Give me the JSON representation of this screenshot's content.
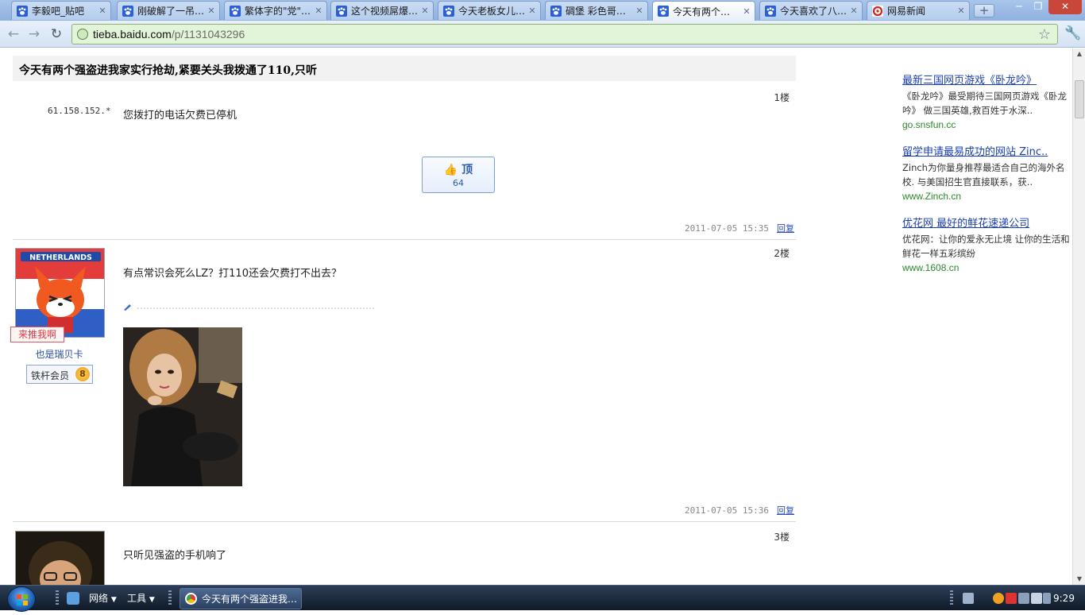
{
  "browser": {
    "tabs": [
      {
        "title": "李毅吧_贴吧",
        "active": false
      },
      {
        "title": "刚破解了一吊…",
        "active": false
      },
      {
        "title": "繁体字的\"党\"…",
        "active": false
      },
      {
        "title": "这个视频屌爆…",
        "active": false
      },
      {
        "title": "今天老板女儿…",
        "active": false
      },
      {
        "title": "碉堡 彩色哥…",
        "active": false
      },
      {
        "title": "今天有两个…",
        "active": true
      },
      {
        "title": "今天喜欢了八…",
        "active": false
      },
      {
        "title": "网易新闻",
        "active": false
      }
    ],
    "new_tab_label": "+",
    "url_host": "tieba.baidu.com",
    "url_path": "/p/1131043296",
    "window_controls": {
      "minimize": "─",
      "restore": "❐",
      "close": "✕"
    }
  },
  "thread": {
    "title": "今天有两个强盗进我家实行抢劫,紧要关头我拨通了110,只听",
    "posts": [
      {
        "floor": "1楼",
        "author_ip": "61.158.152.*",
        "text": "您拨打的电话欠费已停机",
        "upvote_label": "顶",
        "upvote_count": "64",
        "time": "2011-07-05 15:35",
        "reply_label": "回复"
      },
      {
        "floor": "2楼",
        "username": "也是瑞贝卡",
        "member_label": "铁杆会员",
        "level": "8",
        "recommend_label": "来推我啊",
        "avatar_banner": "NETHERLANDS",
        "text": "有点常识会死么LZ？打110还会欠费打不出去？",
        "time": "2011-07-05 15:36",
        "reply_label": "回复"
      },
      {
        "floor": "3楼",
        "text": "只听见强盗的手机响了"
      }
    ]
  },
  "ads": [
    {
      "title": "最新三国网页游戏《卧龙吟》",
      "desc": "《卧龙吟》最受期待三国网页游戏《卧龙吟》 做三国英雄,救百姓于水深..",
      "url": "go.snsfun.cc"
    },
    {
      "title": "留学申请最易成功的网站 Zinc..",
      "desc": "Zinch为你量身推荐最适合自己的海外名校. 与美国招生官直接联系，获..",
      "url": "www.Zinch.cn"
    },
    {
      "title": "优花网 最好的鲜花速递公司",
      "desc": "优花网：让你的爱永无止境 让你的生活和鲜花一样五彩缤纷",
      "url": "www.1608.cn"
    }
  ],
  "taskbar": {
    "network_label": "网络",
    "tools_label": "工具",
    "active_window": "今天有两个强盗进我…",
    "clock": "9:29"
  },
  "colors": {
    "link": "#1a3fb0",
    "ad_url": "#2a8a2a",
    "omnibox_bg": "#e3f5d8"
  }
}
